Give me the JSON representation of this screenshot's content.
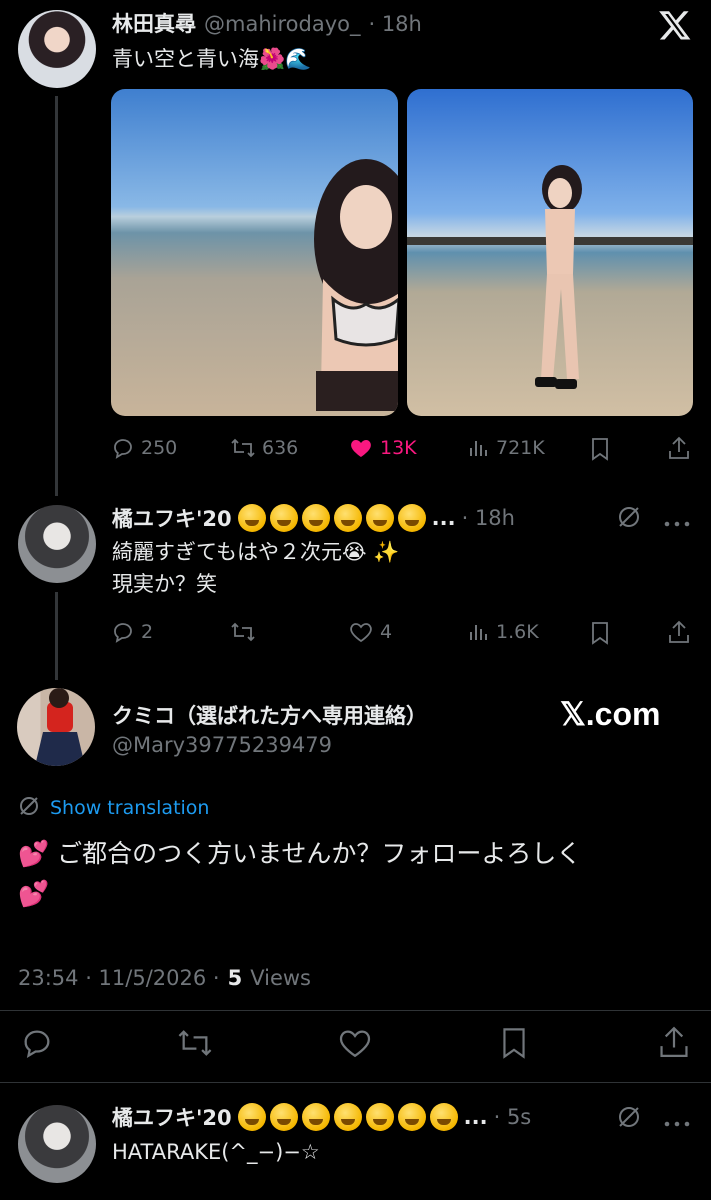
{
  "tweet1": {
    "name": "林田真尋",
    "handle": "@mahirodayo_",
    "time": "· 18h",
    "text": "青い空と青い海",
    "emoji_1": "🌺",
    "emoji_2": "🌊",
    "replies": "250",
    "retweets": "636",
    "likes": "13K",
    "views": "721K",
    "like_color": "#f91880"
  },
  "reply1": {
    "name": "橘ユフキ'20",
    "ellipsis": "...",
    "time": "· 18h",
    "line1": "綺麗すぎてもはや２次元",
    "line1_emoji": "😭 ✨",
    "line2": "現実か？笑",
    "replies": "2",
    "likes": "4",
    "views": "1.6K"
  },
  "main": {
    "name": "クミコ（選ばれた方へ専用連絡）",
    "handle": "@Mary39775239479",
    "watermark": "𝕏.com",
    "show_translation": "Show translation",
    "emoji_lead": "💕",
    "text_line1": "ご都合のつく方いませんか？フォローよろしく",
    "emoji_tail": "💕",
    "timestamp": "23:54 · 11/5/2026 ·",
    "views_count": "5",
    "views_label": "Views",
    "link_color": "#1d9bf0"
  },
  "reply2": {
    "name": "橘ユフキ'20",
    "ellipsis": "...",
    "time": "· 5s",
    "text": "HATARAKE(^_−)−☆"
  },
  "icons": {
    "close": "x-logo-icon",
    "reply": "reply-icon",
    "retweet": "retweet-icon",
    "like": "heart-icon",
    "views": "views-icon",
    "bookmark": "bookmark-icon",
    "share": "share-icon",
    "grok": "grok-icon",
    "more": "more-icon",
    "translate": "translate-icon"
  }
}
